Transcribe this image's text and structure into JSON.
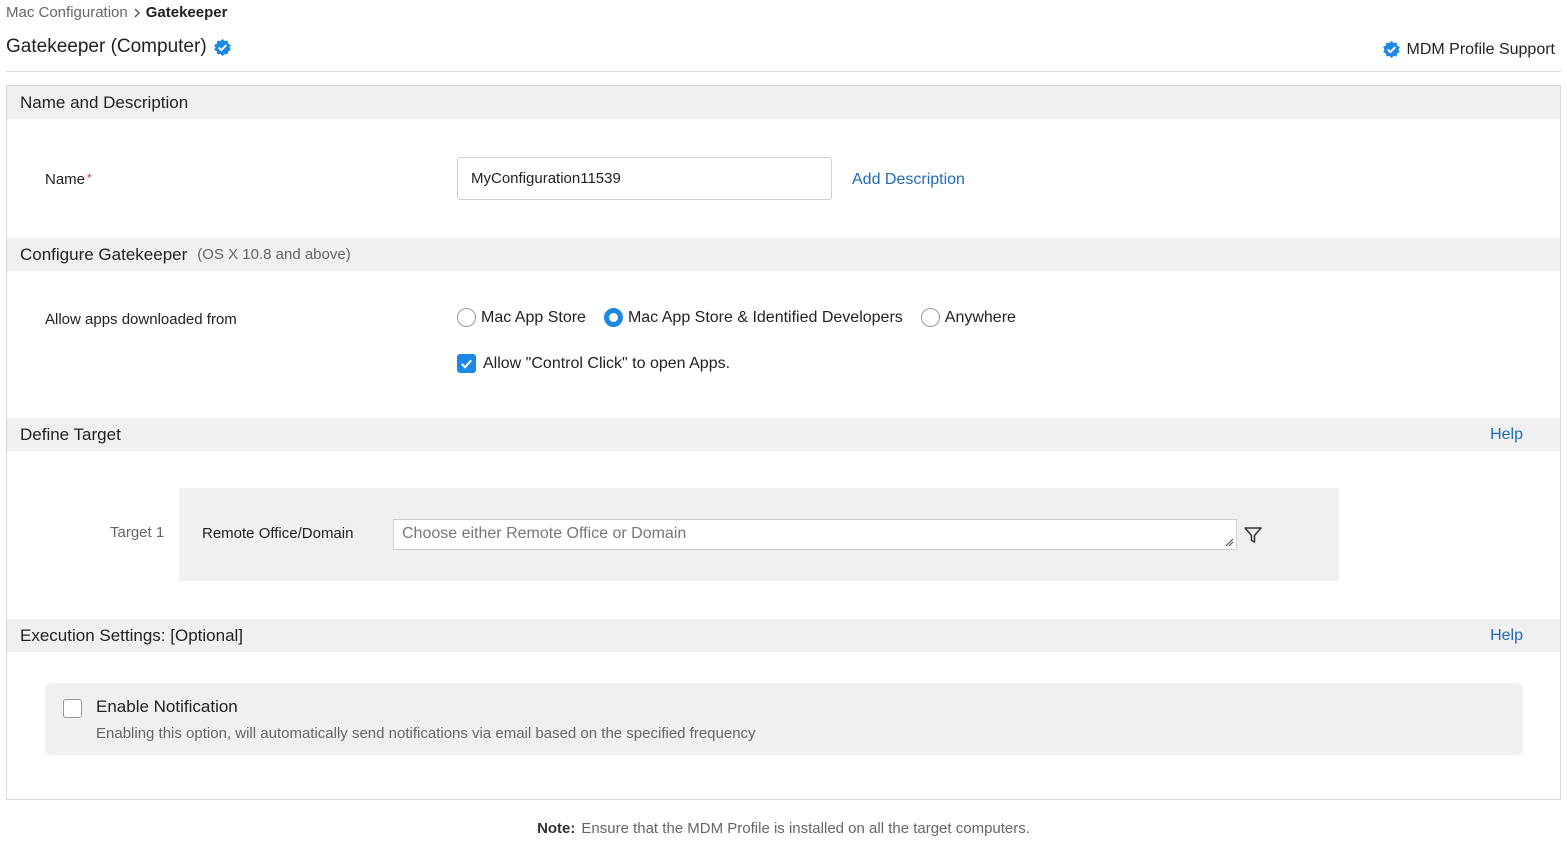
{
  "breadcrumb": {
    "parent": "Mac Configuration",
    "current": "Gatekeeper"
  },
  "page": {
    "title": "Gatekeeper (Computer)",
    "mdm_support": "MDM Profile Support"
  },
  "colors": {
    "accent": "#1e88e5",
    "link": "#1e6bb8",
    "section_bg": "#f0f0f0",
    "required": "#e0312e"
  },
  "name_section": {
    "heading": "Name and Description",
    "name_label": "Name",
    "required_mark": "*",
    "name_value": "MyConfiguration11539",
    "add_description": "Add Description"
  },
  "gatekeeper_section": {
    "heading": "Configure Gatekeeper",
    "subheading": "(OS X 10.8 and above)",
    "allow_label": "Allow apps downloaded from",
    "options": [
      {
        "label": "Mac App Store",
        "selected": false
      },
      {
        "label": "Mac App Store & Identified Developers",
        "selected": true
      },
      {
        "label": "Anywhere",
        "selected": false
      }
    ],
    "control_click_label": "Allow \"Control Click\" to open Apps.",
    "control_click_checked": true
  },
  "target_section": {
    "heading": "Define Target",
    "help": "Help",
    "target_number": "Target 1",
    "target_type": "Remote Office/Domain",
    "target_placeholder": "Choose either Remote Office or Domain",
    "filter_icon": "filter-icon"
  },
  "execution_section": {
    "heading": "Execution Settings: [Optional]",
    "help": "Help",
    "notification_title": "Enable Notification",
    "notification_desc": "Enabling this option, will automatically send notifications via email based on the specified frequency",
    "notification_checked": false
  },
  "note": {
    "label": "Note:",
    "text": "Ensure that the MDM Profile is installed on all the target computers."
  }
}
